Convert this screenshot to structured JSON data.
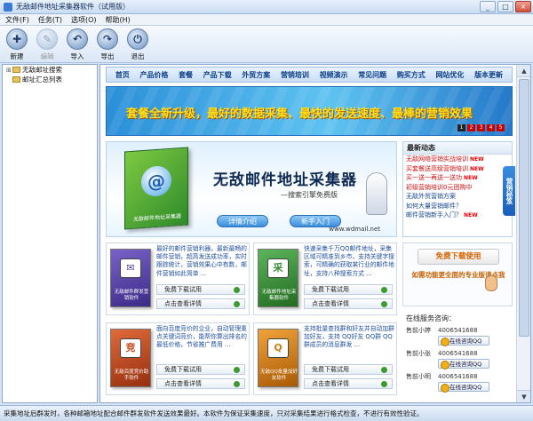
{
  "window": {
    "title": "无敌邮件地址采集器软件（试用版）",
    "min": "_",
    "max": "□",
    "close": "×"
  },
  "menu": [
    "文件(F)",
    "任务(T)",
    "选项(O)",
    "帮助(H)"
  ],
  "toolbar": [
    {
      "label": "新建",
      "icon": "new-icon",
      "glyph": "✚",
      "enabled": true
    },
    {
      "label": "编辑",
      "icon": "edit-icon",
      "glyph": "✎",
      "enabled": false
    },
    {
      "label": "导入",
      "icon": "import-icon",
      "glyph": "↶",
      "enabled": true
    },
    {
      "label": "导出",
      "icon": "export-icon",
      "glyph": "↷",
      "enabled": true
    },
    {
      "label": "退出",
      "icon": "power-icon",
      "glyph": "⏻",
      "enabled": true
    }
  ],
  "tree": [
    {
      "label": "无敌邮址搜索",
      "expander": "⊞"
    },
    {
      "label": "邮址汇总列表",
      "expander": ""
    }
  ],
  "site": {
    "nav": [
      "首页",
      "产品价格",
      "套餐",
      "产品下载",
      "外贸方案",
      "营销培训",
      "视频演示",
      "常见问题",
      "购买方式",
      "网站优化",
      "版本更新"
    ],
    "banner": {
      "text": "套餐全新升级，最好的数据采集、最快的发送速度、最棒的营销效果",
      "dots": [
        "1",
        "2",
        "3",
        "4",
        "5"
      ]
    },
    "hero": {
      "product_name": "无敌邮件地址采集器",
      "box_label": "无敌邮件地址采集器",
      "subtitle": "—搜索引擎免费版",
      "btn1": "详情介绍",
      "btn2": "新手入门",
      "url": "www.wdmail.net"
    },
    "news": {
      "title": "最新动态",
      "items": [
        {
          "text": "无敌网络营销实战培训",
          "new": "NEW",
          "color": "red"
        },
        {
          "text": "买套餐送高级营销培训",
          "new": "NEW",
          "color": "red"
        },
        {
          "text": "买一送一再送一送功",
          "new": "NEW",
          "color": "red"
        },
        {
          "text": "初级营销培训0元团购中",
          "new": "",
          "color": "red"
        },
        {
          "text": "无敌外贸营销方案",
          "new": "",
          "color": "blue"
        },
        {
          "text": "如何大量营销邮件？",
          "new": "",
          "color": "blue"
        },
        {
          "text": "邮件营销新手入门？",
          "new": "NEW",
          "color": "blue"
        }
      ]
    },
    "products": [
      {
        "name": "无敌邮件群发营销软件",
        "glyph": "✉",
        "desc": "最好的邮件营销利器，最新最畅的邮件营销，超高发送成功率，实时跟踪统计，营销效果心中有数，邮件营销如此简单 ...",
        "btn1": "免费下载试用",
        "btn2": "点击查看详情",
        "bg": "#5a3fa8"
      },
      {
        "name": "无敌邮件地址采集器软件",
        "glyph": "采",
        "desc": "快速采集千万QQ邮件地址，采集区域可精准到乡市，支持关键字搜索，可精确的获取某行业的邮件地址，支持八种搜索方式 ...",
        "btn1": "免费下载试用",
        "btn2": "点击查看详情",
        "bg": "#3b8f3a"
      },
      {
        "name": "无敌百度竞价助手软件",
        "glyph": "竞",
        "desc": "面向百度竞价的企业，自动管理重点关键词竞价，能帮你算出排名的最低价格，节省推广费用 ...",
        "btn1": "免费下载试用",
        "btn2": "点击查看详情",
        "bg": "#c64a1d"
      },
      {
        "name": "无敌QQ批量加好友软件",
        "glyph": "Q",
        "desc": "支持批量查找群和好友并自动加群加好友，支持 QQ好友 QQ群 QQ群成员的消息群发 ...",
        "btn1": "免费下载试用",
        "btn2": "点击查看详情",
        "bg": "#d07a15"
      }
    ],
    "free": {
      "button": "免费下载使用",
      "text": "如需功能更全面的专业版请点我"
    },
    "service": {
      "title": "在线服务咨询：",
      "reps": [
        {
          "name": "售前小婷",
          "phone": "4006541688",
          "qq": "在线咨询QQ"
        },
        {
          "name": "售前小张",
          "phone": "4006541688",
          "qq": "在线咨询QQ"
        },
        {
          "name": "售前小明",
          "phone": "4006541688",
          "qq": "在线咨询QQ"
        }
      ]
    },
    "side_tag": "营销秘笈"
  },
  "status": "采集地址后群发时，各种邮箱地址配合邮件群发软件发送效果最好。本软件为保证采集速度，只对采集结果进行格式检查，不进行有效性验证。"
}
